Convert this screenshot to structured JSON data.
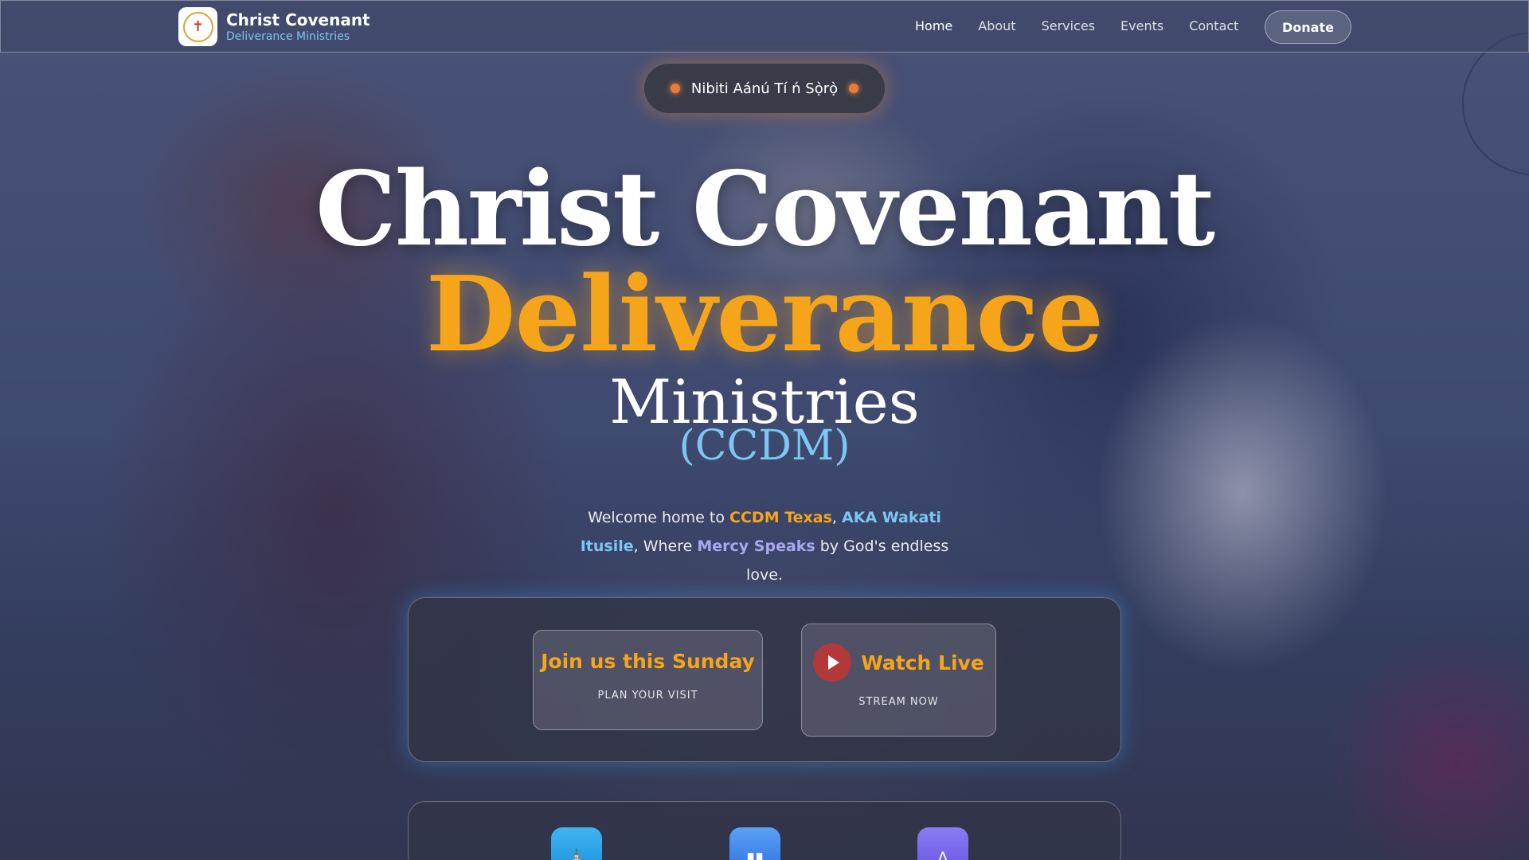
{
  "nav": {
    "brand_title": "Christ Covenant",
    "brand_subtitle": "Deliverance Ministries",
    "logo_icon": "church-seal-logo",
    "items": [
      {
        "label": "Home",
        "active": true
      },
      {
        "label": "About",
        "active": false
      },
      {
        "label": "Services",
        "active": false
      },
      {
        "label": "Events",
        "active": false
      },
      {
        "label": "Contact",
        "active": false
      }
    ],
    "donate_label": "Donate"
  },
  "hero": {
    "pill_text": "Nibiti Aánú Tí ń Sọ̀rọ̀",
    "title_line1": "Christ Covenant",
    "title_line2": "Deliverance",
    "title_line3": "Ministries",
    "title_line4": "(CCDM)",
    "welcome": {
      "t1": "Welcome home to ",
      "h1": "CCDM Texas",
      "t2": ", ",
      "h2": "AKA Wakati Itusile",
      "t3": ", Where ",
      "h3": "Mercy Speaks",
      "t4": " by God's endless love."
    }
  },
  "cta": {
    "sunday_title": "Join us this Sunday",
    "sunday_sub": "PLAN YOUR VISIT",
    "live_title": "Watch Live",
    "live_sub": "STREAM NOW"
  },
  "features": [
    {
      "icon": "church-icon"
    },
    {
      "icon": "bible-icon"
    },
    {
      "icon": "praying-hands-icon"
    }
  ],
  "colors": {
    "accent_orange": "#f6a51b",
    "accent_blue": "#7cc6f4",
    "accent_purple": "#a8a8f0",
    "live_red": "#b3383a"
  }
}
